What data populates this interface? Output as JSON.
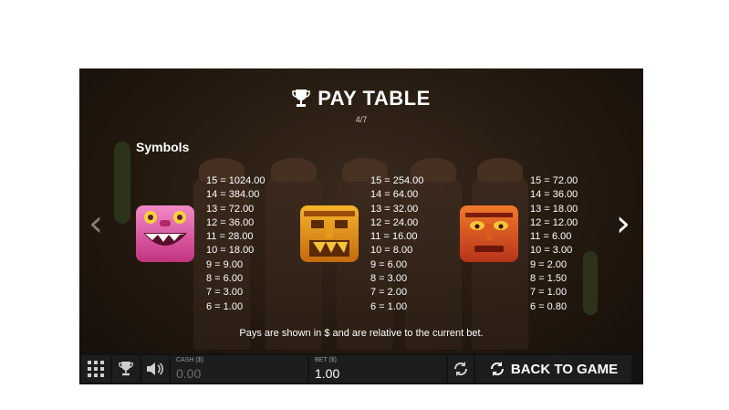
{
  "header": {
    "title": "PAY TABLE",
    "page": "4/7",
    "section": "Symbols"
  },
  "paytables": [
    {
      "symbol": "pink-monster",
      "rows": [
        "15 = 1024.00",
        "14 = 384.00",
        "13 = 72.00",
        "12 = 36.00",
        "11 = 28.00",
        "10 = 18.00",
        "9 = 9.00",
        "8 = 6.00",
        "7 = 3.00",
        "6 = 1.00"
      ]
    },
    {
      "symbol": "gold-mask",
      "rows": [
        "15 = 254.00",
        "14 = 64.00",
        "13 = 32.00",
        "12 = 24.00",
        "11 = 16.00",
        "10 = 8.00",
        "9 = 6.00",
        "8 = 3.00",
        "7 = 2.00",
        "6 = 1.00"
      ]
    },
    {
      "symbol": "red-mask",
      "rows": [
        "15 = 72.00",
        "14 = 36.00",
        "13 = 18.00",
        "12 = 12.00",
        "11 = 6.00",
        "10 = 3.00",
        "9 = 2.00",
        "8 = 1.50",
        "7 = 1.00",
        "6 = 0.80"
      ]
    }
  ],
  "note": "Pays are shown in $ and are relative to the current bet.",
  "nav": {
    "prev": "‹",
    "next": "›"
  },
  "bottom_bar": {
    "cash_label": "CASH ($)",
    "cash_value": "0.00",
    "bet_label": "BET ($)",
    "bet_value": "1.00",
    "back_label": "BACK TO GAME"
  },
  "colors": {
    "cash_value": "#6e6e6e",
    "bet_value": "#ffffff",
    "accent": "#ffffff"
  }
}
